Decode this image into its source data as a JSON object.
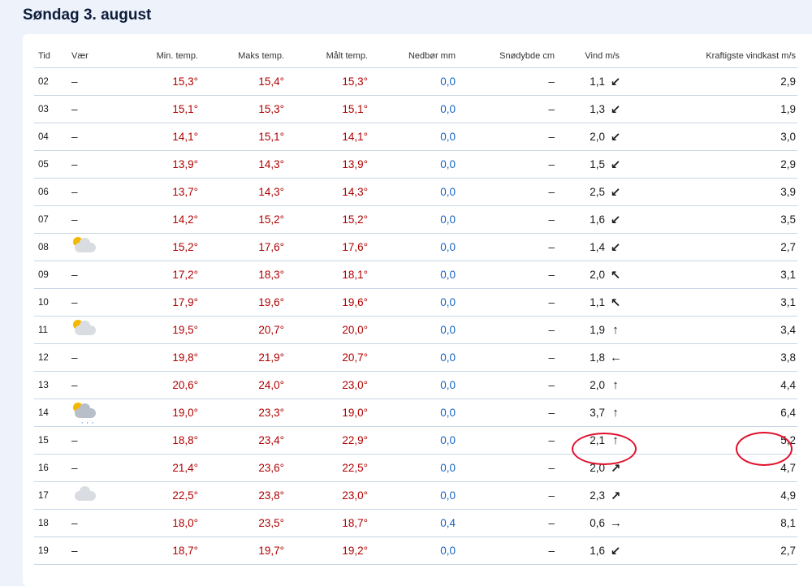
{
  "page_title": "Søndag 3. august",
  "headers": {
    "time": "Tid",
    "weather": "Vær",
    "min_temp": "Min. temp.",
    "max_temp": "Maks temp.",
    "measured_temp": "Målt temp.",
    "precip": "Nedbør mm",
    "snow": "Snødybde cm",
    "wind": "Vind m/s",
    "gust": "Kraftigste vindkast m/s"
  },
  "colors": {
    "temp": "#b00000",
    "precip": "#1a66c2",
    "annotation": "#e0102b"
  },
  "rows": [
    {
      "time": "02",
      "weather": "–",
      "weather_icon": null,
      "min": "15,3°",
      "max": "15,4°",
      "measured": "15,3°",
      "precip": "0,0",
      "snow": "–",
      "wind": "1,1",
      "wind_arrow": "↙",
      "gust": "2,9"
    },
    {
      "time": "03",
      "weather": "–",
      "weather_icon": null,
      "min": "15,1°",
      "max": "15,3°",
      "measured": "15,1°",
      "precip": "0,0",
      "snow": "–",
      "wind": "1,3",
      "wind_arrow": "↙",
      "gust": "1,9"
    },
    {
      "time": "04",
      "weather": "–",
      "weather_icon": null,
      "min": "14,1°",
      "max": "15,1°",
      "measured": "14,1°",
      "precip": "0,0",
      "snow": "–",
      "wind": "2,0",
      "wind_arrow": "↙",
      "gust": "3,0"
    },
    {
      "time": "05",
      "weather": "–",
      "weather_icon": null,
      "min": "13,9°",
      "max": "14,3°",
      "measured": "13,9°",
      "precip": "0,0",
      "snow": "–",
      "wind": "1,5",
      "wind_arrow": "↙",
      "gust": "2,9"
    },
    {
      "time": "06",
      "weather": "–",
      "weather_icon": null,
      "min": "13,7°",
      "max": "14,3°",
      "measured": "14,3°",
      "precip": "0,0",
      "snow": "–",
      "wind": "2,5",
      "wind_arrow": "↙",
      "gust": "3,9"
    },
    {
      "time": "07",
      "weather": "–",
      "weather_icon": null,
      "min": "14,2°",
      "max": "15,2°",
      "measured": "15,2°",
      "precip": "0,0",
      "snow": "–",
      "wind": "1,6",
      "wind_arrow": "↙",
      "gust": "3,5"
    },
    {
      "time": "08",
      "weather": "",
      "weather_icon": "partly-cloudy-icon",
      "min": "15,2°",
      "max": "17,6°",
      "measured": "17,6°",
      "precip": "0,0",
      "snow": "–",
      "wind": "1,4",
      "wind_arrow": "↙",
      "gust": "2,7"
    },
    {
      "time": "09",
      "weather": "–",
      "weather_icon": null,
      "min": "17,2°",
      "max": "18,3°",
      "measured": "18,1°",
      "precip": "0,0",
      "snow": "–",
      "wind": "2,0",
      "wind_arrow": "↖",
      "gust": "3,1"
    },
    {
      "time": "10",
      "weather": "–",
      "weather_icon": null,
      "min": "17,9°",
      "max": "19,6°",
      "measured": "19,6°",
      "precip": "0,0",
      "snow": "–",
      "wind": "1,1",
      "wind_arrow": "↖",
      "gust": "3,1"
    },
    {
      "time": "11",
      "weather": "",
      "weather_icon": "partly-cloudy-icon",
      "min": "19,5°",
      "max": "20,7°",
      "measured": "20,0°",
      "precip": "0,0",
      "snow": "–",
      "wind": "1,9",
      "wind_arrow": "↑",
      "gust": "3,4"
    },
    {
      "time": "12",
      "weather": "–",
      "weather_icon": null,
      "min": "19,8°",
      "max": "21,9°",
      "measured": "20,7°",
      "precip": "0,0",
      "snow": "–",
      "wind": "1,8",
      "wind_arrow": "←",
      "gust": "3,8"
    },
    {
      "time": "13",
      "weather": "–",
      "weather_icon": null,
      "min": "20,6°",
      "max": "24,0°",
      "measured": "23,0°",
      "precip": "0,0",
      "snow": "–",
      "wind": "2,0",
      "wind_arrow": "↑",
      "gust": "4,4"
    },
    {
      "time": "14",
      "weather": "",
      "weather_icon": "rain-showers-icon",
      "min": "19,0°",
      "max": "23,3°",
      "measured": "19,0°",
      "precip": "0,0",
      "snow": "–",
      "wind": "3,7",
      "wind_arrow": "↑",
      "gust": "6,4"
    },
    {
      "time": "15",
      "weather": "–",
      "weather_icon": null,
      "min": "18,8°",
      "max": "23,4°",
      "measured": "22,9°",
      "precip": "0,0",
      "snow": "–",
      "wind": "2,1",
      "wind_arrow": "↑",
      "gust": "5,2"
    },
    {
      "time": "16",
      "weather": "–",
      "weather_icon": null,
      "min": "21,4°",
      "max": "23,6°",
      "measured": "22,5°",
      "precip": "0,0",
      "snow": "–",
      "wind": "2,0",
      "wind_arrow": "↗",
      "gust": "4,7"
    },
    {
      "time": "17",
      "weather": "",
      "weather_icon": "cloud-icon",
      "min": "22,5°",
      "max": "23,8°",
      "measured": "23,0°",
      "precip": "0,0",
      "snow": "–",
      "wind": "2,3",
      "wind_arrow": "↗",
      "gust": "4,9"
    },
    {
      "time": "18",
      "weather": "–",
      "weather_icon": null,
      "min": "18,0°",
      "max": "23,5°",
      "measured": "18,7°",
      "precip": "0,4",
      "snow": "–",
      "wind": "0,6",
      "wind_arrow": "→",
      "gust": "8,1"
    },
    {
      "time": "19",
      "weather": "–",
      "weather_icon": null,
      "min": "18,7°",
      "max": "19,7°",
      "measured": "19,2°",
      "precip": "0,0",
      "snow": "–",
      "wind": "1,6",
      "wind_arrow": "↙",
      "gust": "2,7"
    }
  ]
}
